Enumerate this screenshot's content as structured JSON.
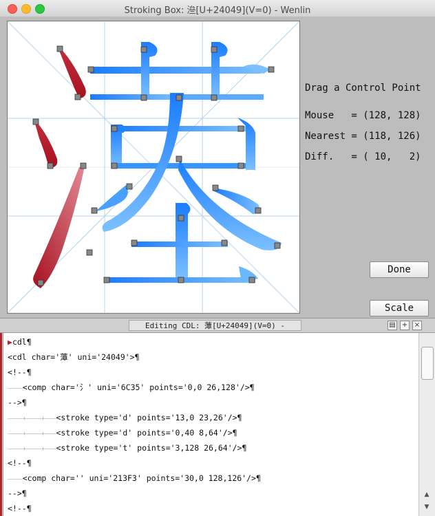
{
  "window": {
    "title": "Stroking Box: 㴉[U+24049](V=0) - Wenlin"
  },
  "info": {
    "heading": "Drag a Control Point",
    "mouse": "Mouse   = (128, 128)",
    "nearest": "Nearest = (118, 126)",
    "diff": "Diff.   = ( 10,   2)"
  },
  "buttons": {
    "done": "Done",
    "scale": "Scale"
  },
  "editor": {
    "title": "Editing CDL: 藫[U+24049](V=0) - Wenlin",
    "lines": [
      "cdl¶",
      "<cdl char='藫' uni='24049'>¶",
      "<!--¶",
      "<comp char='氵' uni='6C35' points='0,0 26,128'/>¶",
      "-->¶",
      "<stroke type='d' points='13,0 23,26'/>¶",
      "<stroke type='d' points='0,40 8,64'/>¶",
      "<stroke type='t' points='3,128 26,64'/>¶",
      "<!--¶",
      "<comp char='𡏳' uni='213F3' points='30,0 128,126'/>¶",
      "-->¶",
      "<!--¶"
    ]
  },
  "colors": {
    "blue": "#1e88ff",
    "red": "#b01828",
    "grid": "#b7d3ef"
  }
}
